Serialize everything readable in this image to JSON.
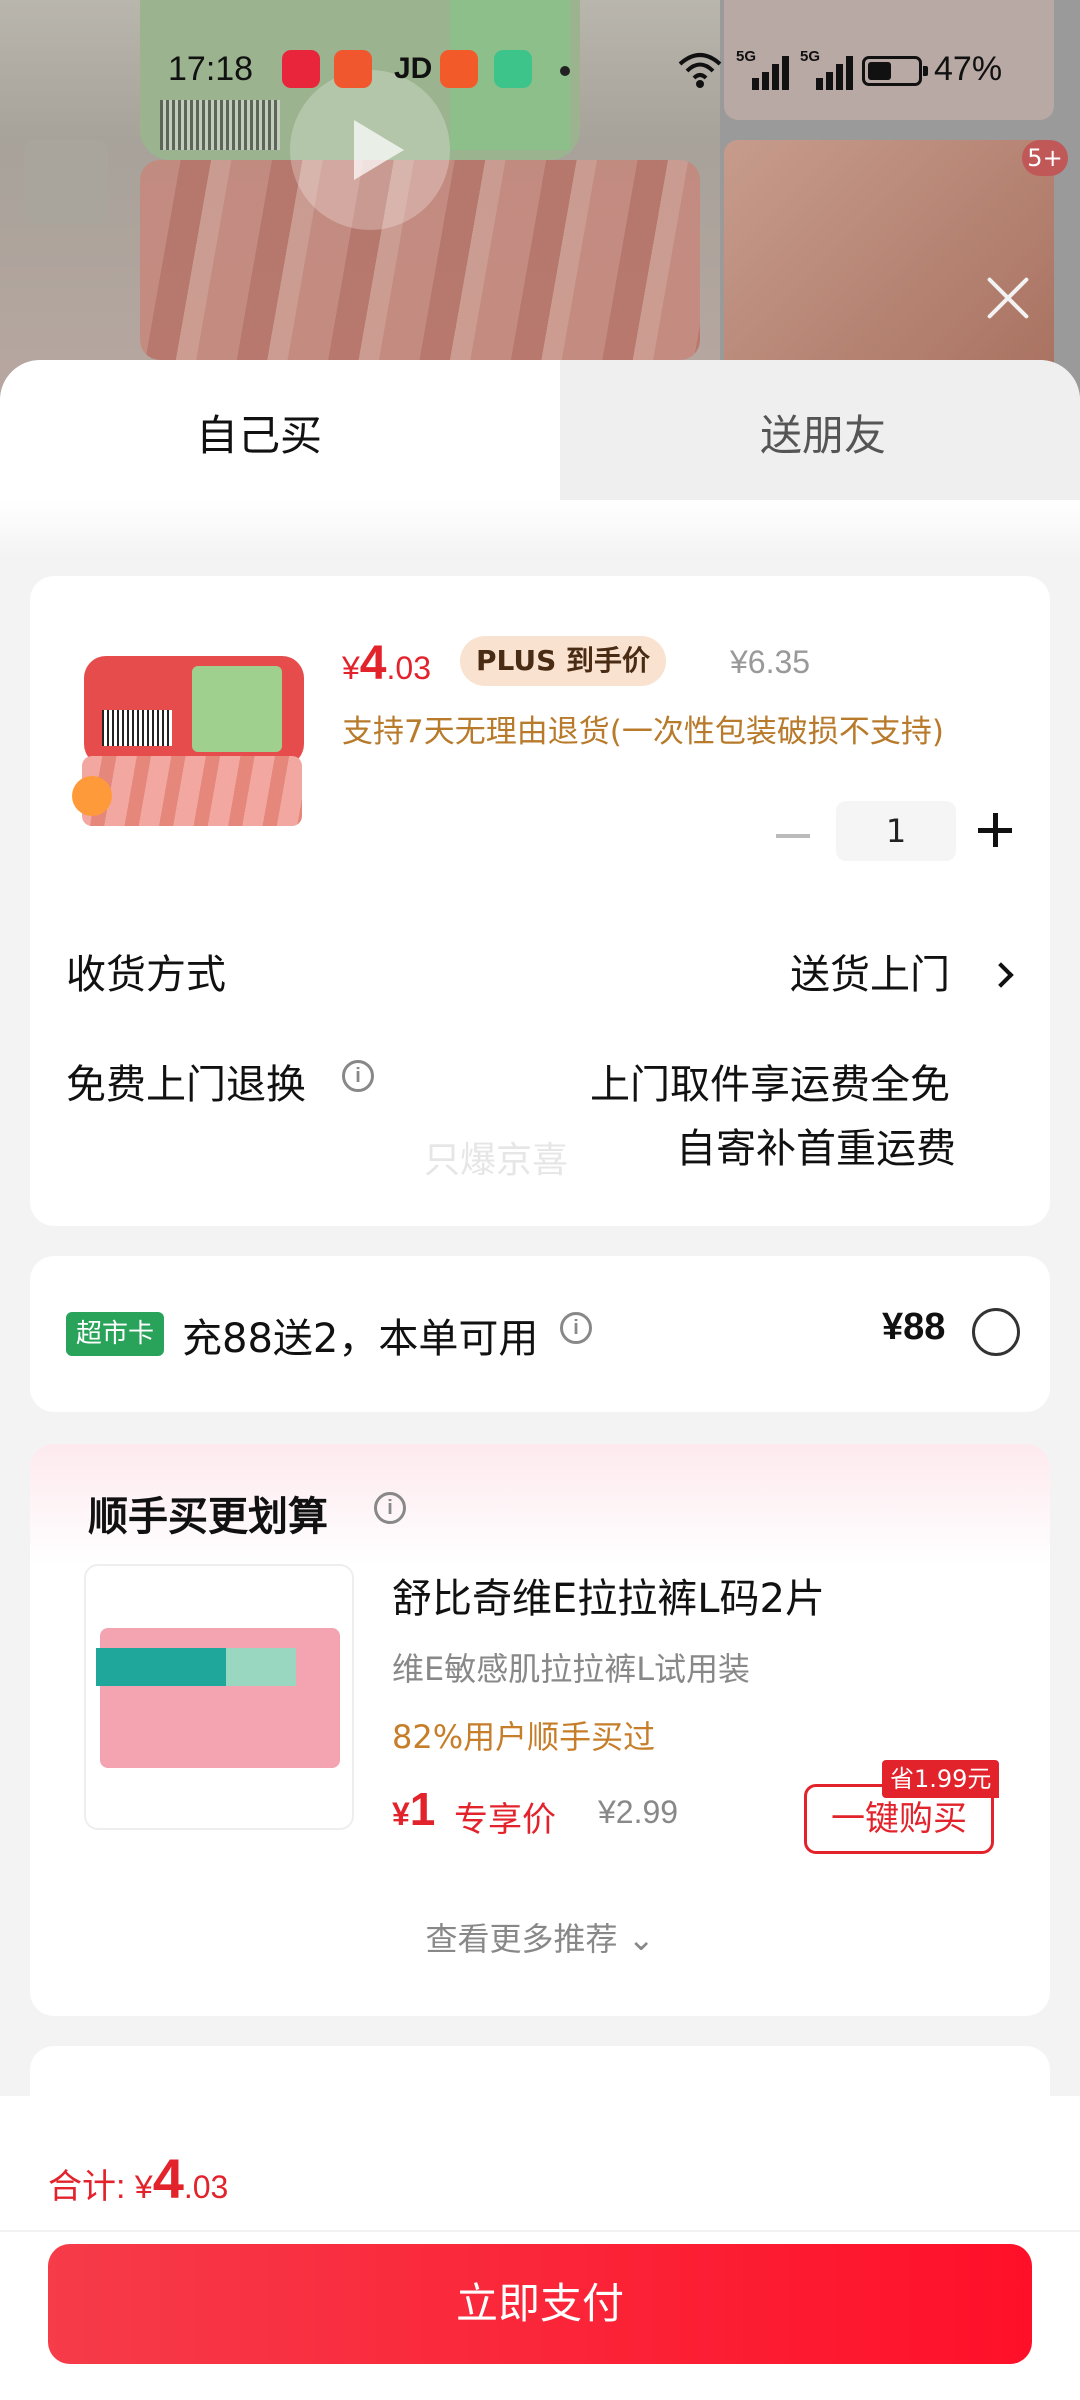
{
  "status_bar": {
    "time": "17:18",
    "jd_label": "JD",
    "net1": "5G",
    "net2": "5G",
    "battery_level": 0.47,
    "battery_text": "47%"
  },
  "background": {
    "image_count_badge": "5+"
  },
  "tabs": [
    {
      "label": "自己买",
      "selected": true
    },
    {
      "label": "送朋友",
      "selected": false
    }
  ],
  "product": {
    "price_currency": "¥",
    "price_int": "4",
    "price_dec": ".03",
    "plus_tag": "PLUS 到手价",
    "original_price": "¥6.35",
    "return_note": "支持7天无理由退货(一次性包装破损不支持)",
    "quantity": "1"
  },
  "delivery": {
    "label": "收货方式",
    "value": "送货上门"
  },
  "free_return": {
    "label": "免费上门退换",
    "line1": "上门取件享运费全免",
    "line2": "自寄补首重运费",
    "watermark": "只爆京喜"
  },
  "supermarket_card": {
    "badge": "超市卡",
    "text": "充88送2，本单可用",
    "price": "¥88"
  },
  "bundle": {
    "title": "顺手买更划算",
    "item_name": "舒比奇维E拉拉裤L码2片",
    "item_sub": "维E敏感肌拉拉裤L试用装",
    "bought_note": "82%用户顺手买过",
    "price_currency": "¥",
    "price_int": "1",
    "exclusive_label": "专享价",
    "original_price": "¥2.99",
    "save_badge": "省1.99元",
    "buy_button": "一键购买",
    "more": "查看更多推荐"
  },
  "footer": {
    "total_label": "合计: ",
    "total_currency": "¥",
    "total_int": "4",
    "total_dec": ".03",
    "pay_button": "立即支付"
  },
  "colors": {
    "accent_red": "#e3232c",
    "pay_gradient_start": "#f63b49",
    "pay_gradient_end": "#ff1029",
    "note_orange": "#b87a2b",
    "supermarket_green": "#2aa35a"
  }
}
